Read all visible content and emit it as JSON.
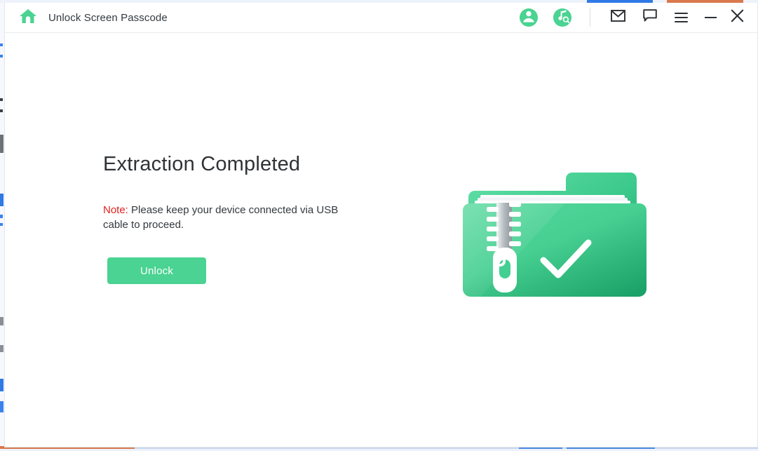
{
  "window": {
    "title": "Unlock Screen Passcode",
    "home_icon": "home-icon"
  },
  "titlebar": {
    "account_icon": "account-avatar-icon",
    "music_search_icon": "music-search-icon",
    "mail_icon": "mail-icon",
    "feedback_icon": "chat-bubble-icon",
    "menu_icon": "hamburger-menu-icon",
    "minimize_icon": "minimize-icon",
    "close_icon": "close-icon"
  },
  "main": {
    "heading": "Extraction Completed",
    "note_label": "Note:",
    "note_text": " Please keep your device connected via USB cable to proceed.",
    "unlock_label": "Unlock",
    "illustration_name": "zipped-folder-complete-illustration"
  },
  "colors": {
    "accent_green": "#4ad392",
    "note_red": "#e02020",
    "heading_gray": "#2f3337",
    "folder_green_dark": "#1fa86a",
    "folder_green_light": "#6fe0ab"
  }
}
